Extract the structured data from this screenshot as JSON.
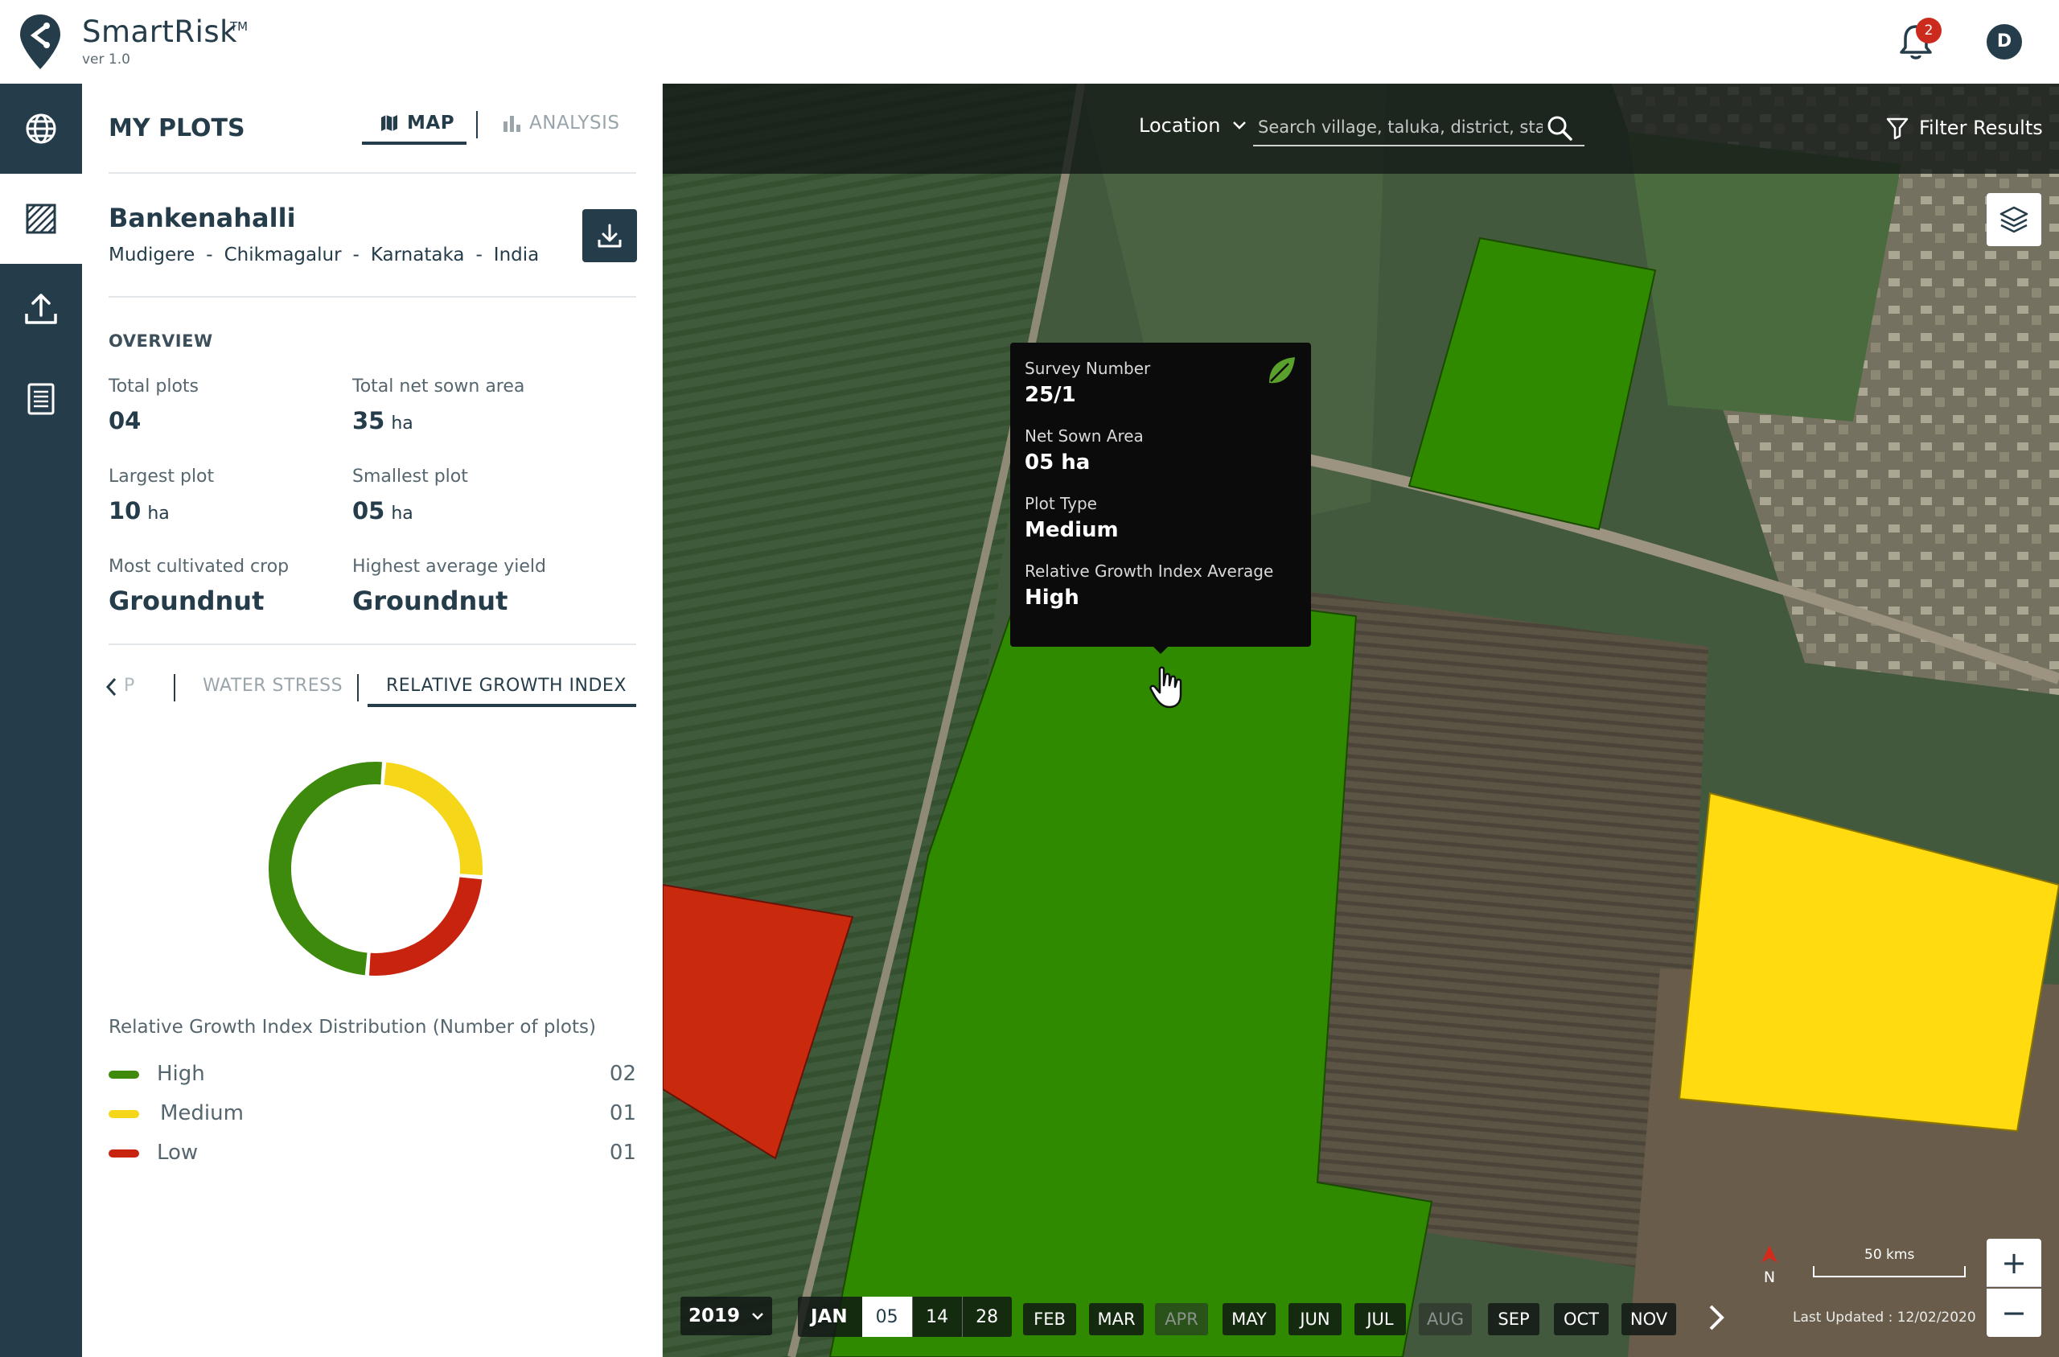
{
  "app": {
    "name": "SmartRisk",
    "tm": "TM",
    "version": "ver 1.0"
  },
  "header": {
    "notification_count": "2",
    "avatar_initial": "D"
  },
  "panel": {
    "title": "MY PLOTS",
    "tabs": {
      "map": "MAP",
      "analysis": "ANALYSIS"
    },
    "location": {
      "name": "Bankenahalli",
      "path": [
        "Mudigere",
        "-",
        "Chikmagalur",
        "-",
        "Karnataka",
        "-",
        "India"
      ]
    },
    "overview": {
      "heading": "OVERVIEW",
      "total_plots_label": "Total plots",
      "total_plots": "04",
      "net_sown_label": "Total net sown area",
      "net_sown": "35",
      "largest_label": "Largest plot",
      "largest": "10",
      "smallest_label": "Smallest plot",
      "smallest": "05",
      "unit": "ha",
      "most_crop_label": "Most cultivated crop",
      "most_crop": "Groundnut",
      "highest_yield_label": "Highest average yield",
      "highest_yield": "Groundnut"
    },
    "metric_tabs": {
      "p": "P",
      "water": "WATER STRESS",
      "rgi": "RELATIVE GROWTH INDEX"
    },
    "distribution": {
      "title": "Relative Growth Index Distribution (Number of plots)",
      "items": [
        {
          "label": "High",
          "count": "02",
          "value": 2,
          "color": "#3e8a0c"
        },
        {
          "label": "Medium",
          "count": "01",
          "value": 1,
          "color": "#f5d619"
        },
        {
          "label": "Low",
          "count": "01",
          "value": 1,
          "color": "#c8230f"
        }
      ]
    }
  },
  "map": {
    "location_label": "Location",
    "search_placeholder": "Search village, taluka, district, state",
    "filter_label": "Filter Results",
    "tooltip": {
      "survey_label": "Survey Number",
      "survey": "25/1",
      "area_label": "Net Sown Area",
      "area": "05 ha",
      "type_label": "Plot Type",
      "type": "Medium",
      "rgi_label": "Relative Growth Index Average",
      "rgi": "High"
    },
    "north": "N",
    "scale": "50 kms",
    "last_updated": "Last Updated : 12/02/2020",
    "zoom_in": "+",
    "zoom_out": "−",
    "timeline": {
      "year": "2019",
      "jan": "JAN",
      "days": [
        "05",
        "14",
        "28"
      ],
      "months": [
        "FEB",
        "MAR",
        "APR",
        "MAY",
        "JUN",
        "JUL",
        "AUG",
        "SEP",
        "OCT",
        "NOV"
      ]
    },
    "plot_colors": {
      "high": "#2f8a00",
      "medium": "#ffdb10",
      "low": "#c92a0e"
    }
  }
}
